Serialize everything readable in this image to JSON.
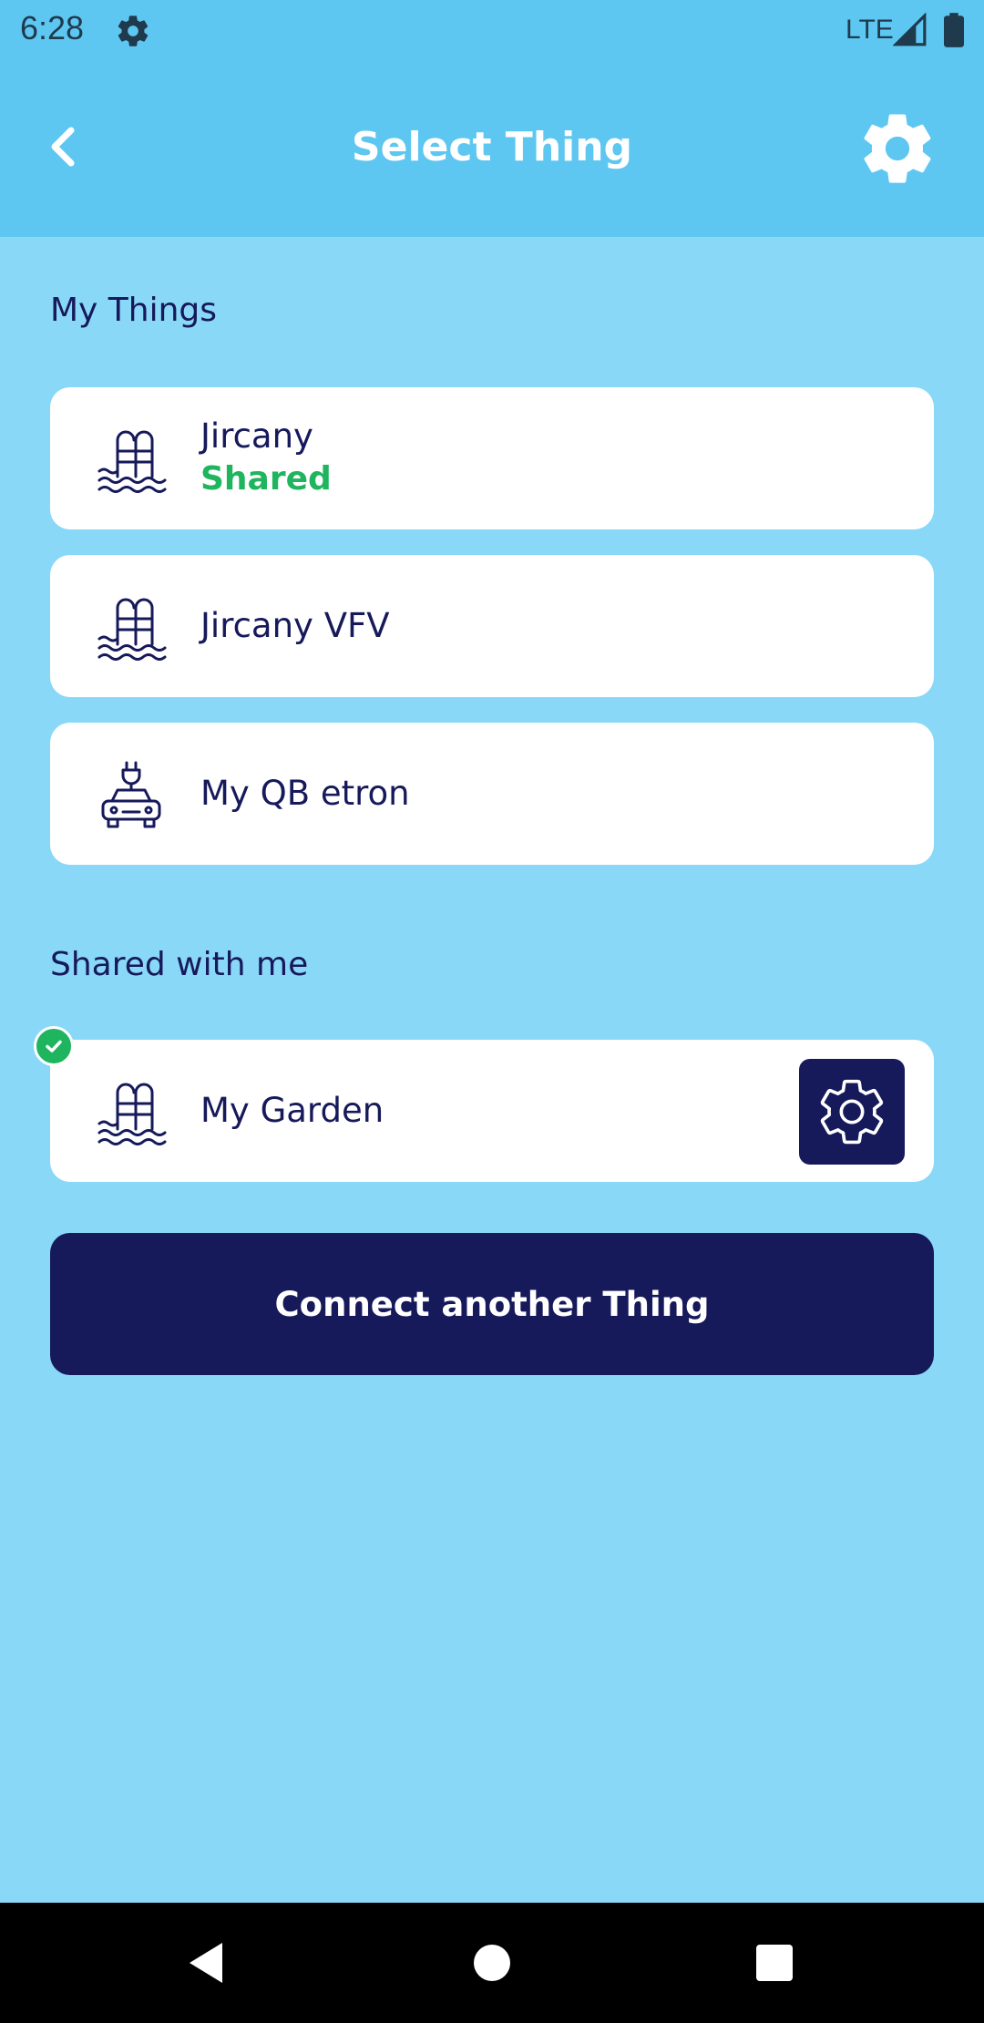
{
  "status_bar": {
    "time": "6:28",
    "network": "LTE",
    "icons": [
      "gear-icon",
      "signal-icon",
      "battery-icon"
    ]
  },
  "app_bar": {
    "title": "Select Thing",
    "back_icon": "chevron-left-icon",
    "settings_icon": "gear-icon"
  },
  "my_things": {
    "title": "My Things",
    "items": [
      {
        "name": "Jircany",
        "subtitle": "Shared",
        "icon": "pool-ladder-icon"
      },
      {
        "name": "Jircany VFV",
        "icon": "pool-ladder-icon"
      },
      {
        "name": "My QB etron",
        "icon": "electric-car-icon"
      }
    ]
  },
  "shared_with_me": {
    "title": "Shared with me",
    "items": [
      {
        "name": "My Garden",
        "icon": "pool-ladder-icon",
        "selected": true,
        "settings_icon": "gear-icon"
      }
    ]
  },
  "connect_button": {
    "label": "Connect another Thing"
  },
  "colors": {
    "background": "#8AD8F8",
    "header": "#5EC7F1",
    "navy": "#16195A",
    "green": "#1FB55E",
    "card": "#FFFFFF"
  },
  "nav_bar": {
    "icons": [
      "back-triangle-icon",
      "home-circle-icon",
      "recents-square-icon"
    ]
  }
}
